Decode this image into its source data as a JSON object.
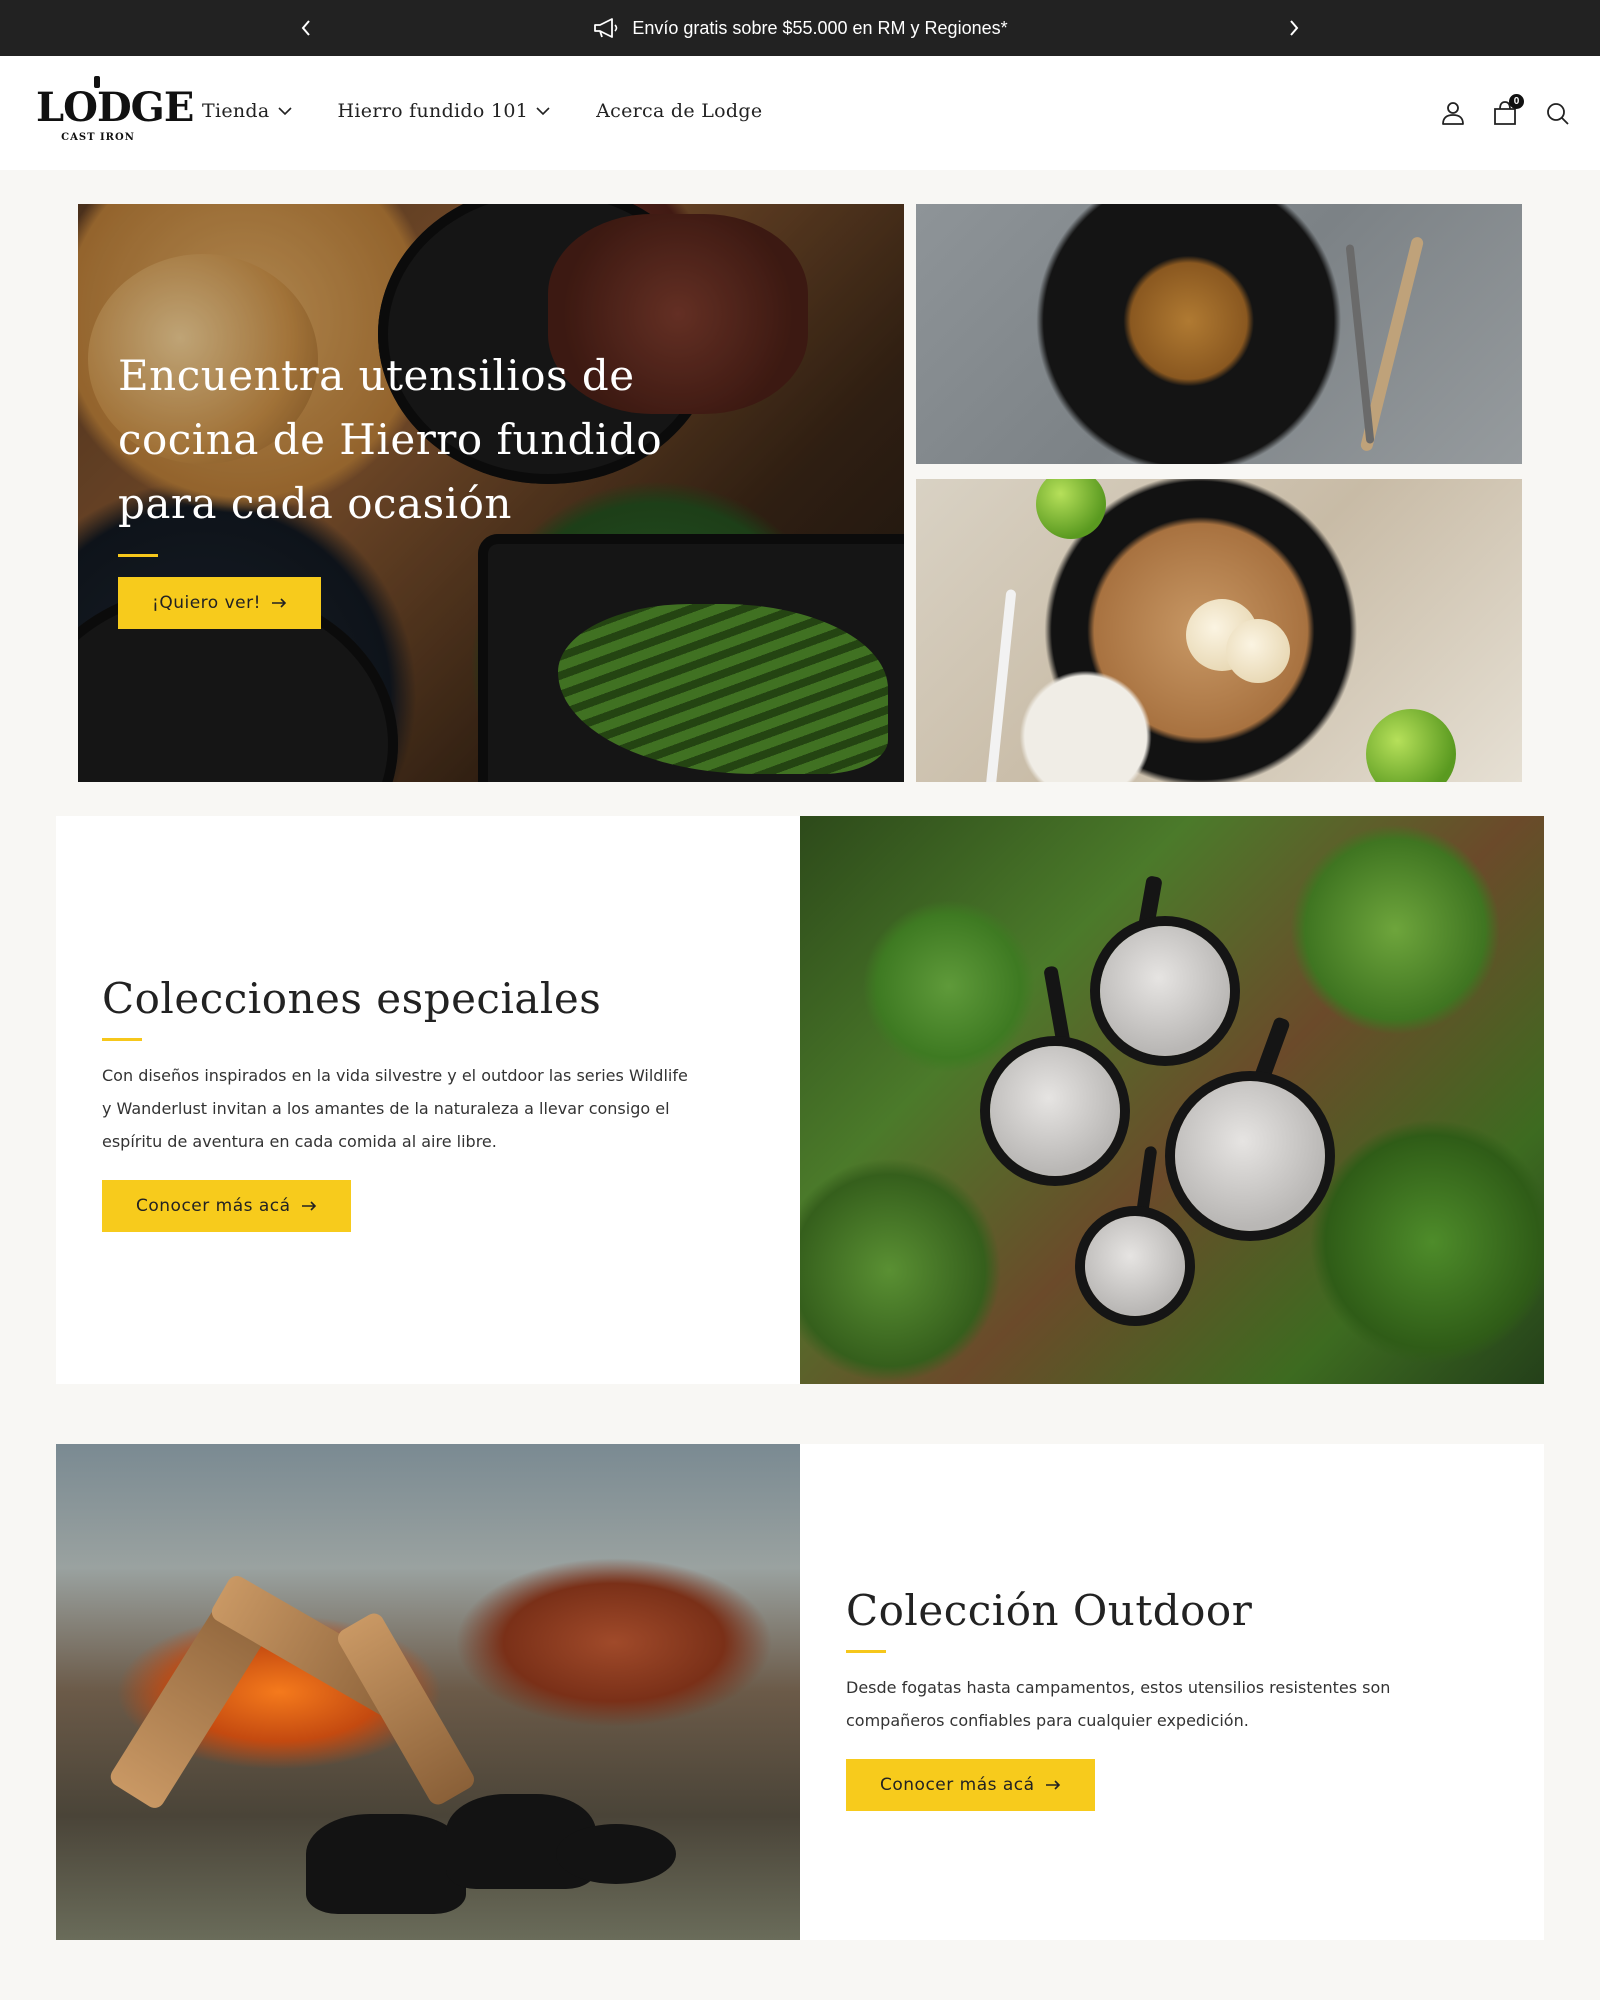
{
  "announcement": {
    "text": "Envío gratis sobre $55.000 en RM y Regiones*",
    "icon": "megaphone-icon"
  },
  "header": {
    "logo_text": "LODGE",
    "logo_subtext": "CAST IRON",
    "nav": [
      {
        "label": "Tienda",
        "has_dropdown": true
      },
      {
        "label": "Hierro fundido 101",
        "has_dropdown": true
      },
      {
        "label": "Acerca de Lodge",
        "has_dropdown": false
      }
    ],
    "cart_count": "0"
  },
  "hero": {
    "title": "Encuentra utensilios de cocina de Hierro fundido para cada ocasión",
    "button_label": "¡Quiero ver!"
  },
  "special_collections": {
    "title": "Colecciones especiales",
    "body": "Con diseños inspirados en la vida silvestre y el outdoor las series Wildlife y Wanderlust invitan a los amantes de la naturaleza a llevar consigo el espíritu de aventura en cada comida al aire libre.",
    "button_label": "Conocer más acá"
  },
  "outdoor_collection": {
    "title": "Colección Outdoor",
    "body": "Desde fogatas hasta campamentos, estos utensilios resistentes son compañeros confiables para cualquier expedición.",
    "button_label": "Conocer más acá"
  },
  "colors": {
    "accent": "#f7cb1c",
    "topbar": "#222222",
    "page_bg": "#f8f7f4"
  }
}
